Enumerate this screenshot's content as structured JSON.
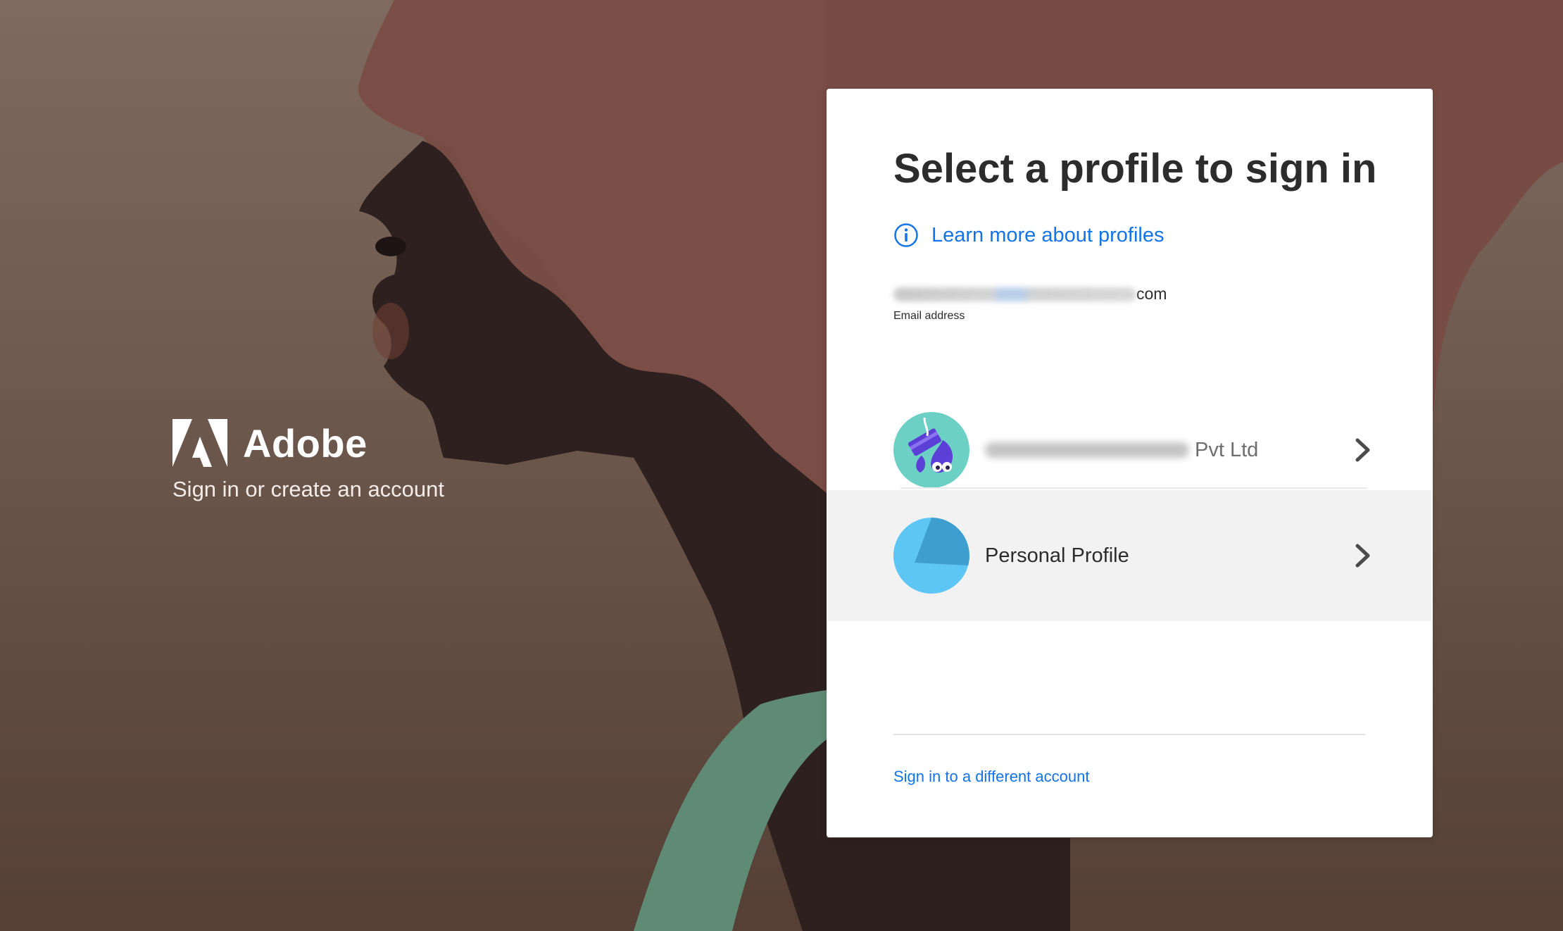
{
  "brand": {
    "name": "Adobe",
    "tagline": "Sign in or create an account"
  },
  "card": {
    "title": "Select a profile to sign in",
    "learn_more_link": "Learn more about profiles",
    "email": {
      "visible_suffix": "com",
      "label": "Email address"
    },
    "profiles": [
      {
        "name_suffix": "Pvt Ltd",
        "name_obscured": true
      },
      {
        "name": "Personal Profile"
      }
    ],
    "different_account_link": "Sign in to a different account"
  },
  "colors": {
    "link": "#1473e6",
    "hover_row": "#f2f2f2",
    "org_avatar": "#6cd0c4",
    "personal_avatar": "#5ec6f5"
  },
  "icons": [
    "adobe-logo-icon",
    "info-icon",
    "chevron-right-icon",
    "org-avatar-icon",
    "personal-avatar-icon"
  ]
}
